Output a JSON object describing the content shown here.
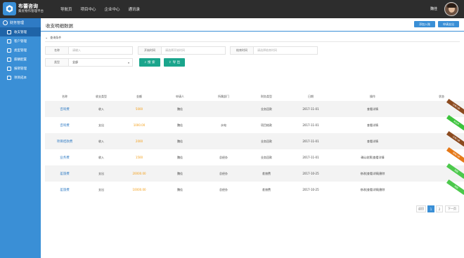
{
  "brand": {
    "name": "布蕾咨询",
    "subtitle": "集优物作管理平台"
  },
  "topnav": [
    "导航页",
    "项目中心",
    "企业中心",
    "通讯录"
  ],
  "user": {
    "name": "魏佳"
  },
  "sidebar": {
    "section": "财务管理",
    "items": [
      {
        "label": "收支管理",
        "active": true
      },
      {
        "label": "客户管理",
        "active": false
      },
      {
        "label": "类型管理",
        "active": false
      },
      {
        "label": "薪酬配置",
        "active": false
      },
      {
        "label": "报销管理",
        "active": false
      },
      {
        "label": "项目成本",
        "active": false
      }
    ]
  },
  "main": {
    "title": "收支明细数据",
    "add_button": "添加入账",
    "apply_button": "申请支出",
    "conditions_label": "查询条件"
  },
  "filters": {
    "name_label": "名称",
    "name_placeholder": "请输入",
    "start_label": "开始时间",
    "start_placeholder": "请选择开始时间",
    "end_label": "结束时间",
    "end_placeholder": "请选择结束时间",
    "type_label": "类型",
    "type_value": "全部",
    "search_button": "搜 索",
    "export_button": "导 出"
  },
  "table": {
    "headers": [
      "名称",
      "收支类型",
      "金额",
      "申请人",
      "所属部门",
      "财务类型",
      "日期",
      "操作",
      "状态"
    ],
    "rows": [
      {
        "name": "咨询费",
        "flow": "收入",
        "amount": "5000",
        "applicant": "魏佳",
        "dept": "",
        "ftype": "业务回款",
        "date": "2017-11-01",
        "ops": [
          "查看详情"
        ],
        "status": "已收入账",
        "status_color": "#8b4a1f"
      },
      {
        "name": "咨询费",
        "flow": "支出",
        "amount": "1000.00",
        "applicant": "魏佳",
        "dept": "水电",
        "ftype": "项目结款",
        "date": "2017-11-01",
        "ops": [
          "查看详情"
        ],
        "status": "支出中",
        "status_color": "#3cc33c"
      },
      {
        "name": "项目结款费",
        "flow": "收入",
        "amount": "2000",
        "applicant": "魏佳",
        "dept": "",
        "ftype": "业务回款",
        "date": "2017-11-01",
        "ops": [
          "查看详情"
        ],
        "status": "已收入账",
        "status_color": "#8b4a1f"
      },
      {
        "name": "业务费",
        "flow": "收入",
        "amount": "1500",
        "applicant": "魏佳",
        "dept": "总经办",
        "ftype": "业务回款",
        "date": "2017-11-01",
        "ops": [
          "确认收票",
          "查看详情"
        ],
        "status": "待收入账",
        "status_color": "#e57817"
      },
      {
        "name": "差旅费",
        "flow": "支出",
        "amount": "20000.00",
        "applicant": "魏佳",
        "dept": "总经办",
        "ftype": "差旅费",
        "date": "2017-10-25",
        "ops": [
          "修改",
          "查看详情",
          "删除"
        ],
        "status": "驳回",
        "status_color": "#4cc94c"
      },
      {
        "name": "差旅费",
        "flow": "支出",
        "amount": "10000.00",
        "applicant": "魏佳",
        "dept": "总经办",
        "ftype": "差旅费",
        "date": "2017-10-25",
        "ops": [
          "修改",
          "查看详情",
          "删除"
        ],
        "status": "驳回",
        "status_color": "#4cc94c"
      }
    ]
  },
  "pagination": {
    "prev": "返回",
    "pages": [
      "1",
      "2"
    ],
    "next": "下一页"
  }
}
